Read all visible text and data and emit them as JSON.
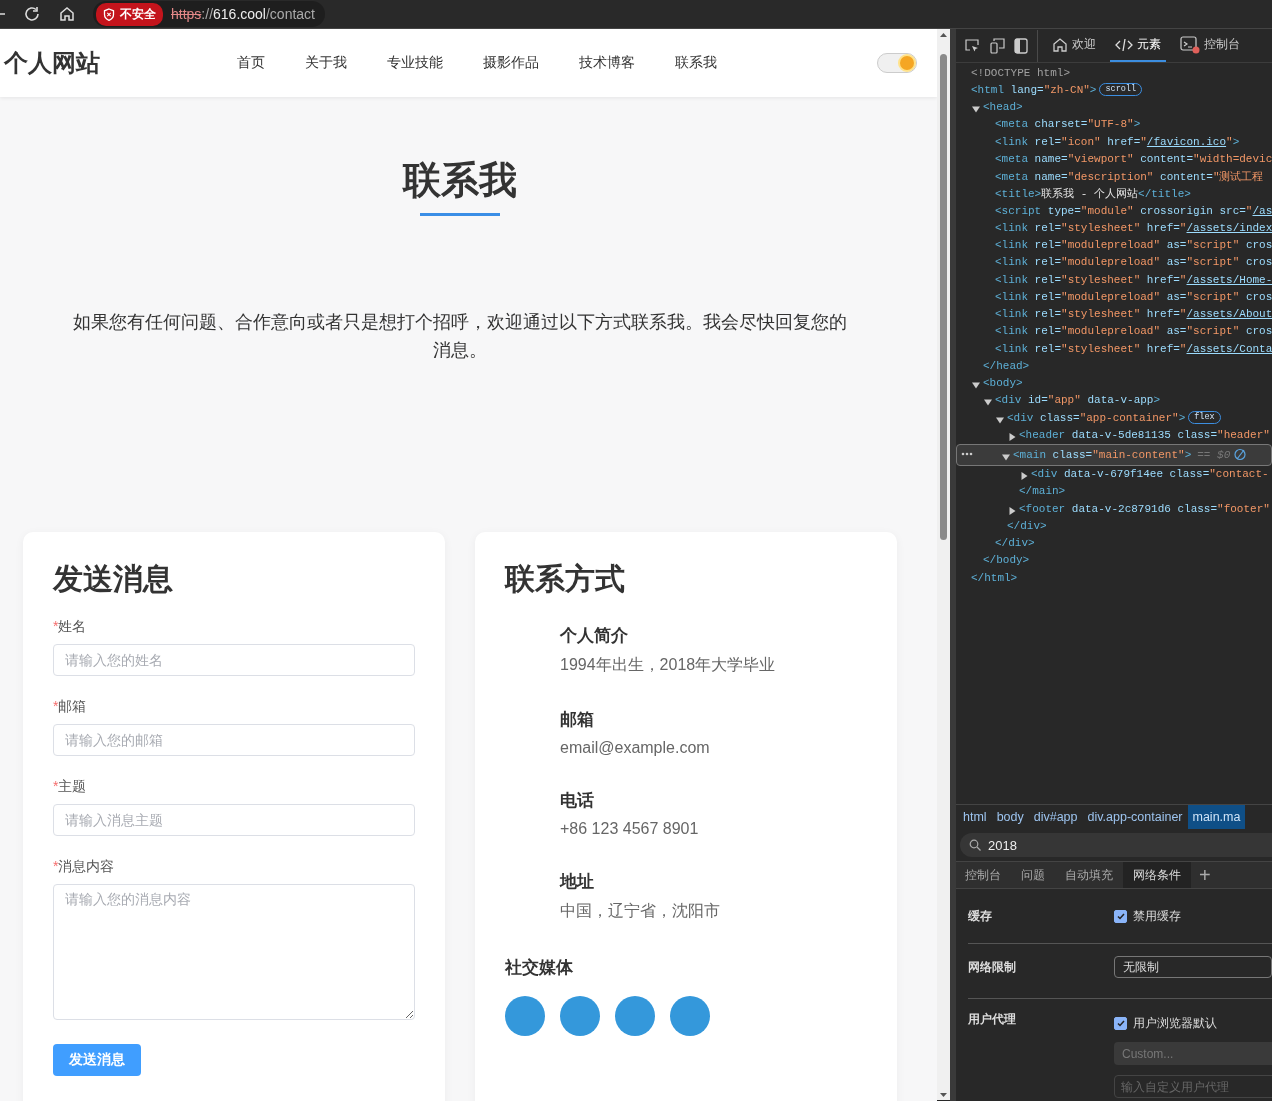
{
  "browser": {
    "security_badge": "不安全",
    "url": {
      "scheme": "https",
      "separator": "://",
      "host": "616.cool",
      "path": "/contact"
    }
  },
  "site": {
    "logo": "个人网站",
    "nav": [
      {
        "label": "首页"
      },
      {
        "label": "关于我"
      },
      {
        "label": "专业技能"
      },
      {
        "label": "摄影作品"
      },
      {
        "label": "技术博客"
      },
      {
        "label": "联系我"
      }
    ],
    "theme_toggle": {
      "on": true
    },
    "title": "联系我",
    "intro": "如果您有任何问题、合作意向或者只是想打个招呼，欢迎通过以下方式联系我。我会尽快回复您的消息。",
    "form": {
      "heading": "发送消息",
      "fields": [
        {
          "kind": "input",
          "label": "姓名",
          "required_mark": "*",
          "placeholder": "请输入您的姓名"
        },
        {
          "kind": "input",
          "label": "邮箱",
          "required_mark": "*",
          "placeholder": "请输入您的邮箱"
        },
        {
          "kind": "input",
          "label": "主题",
          "required_mark": "*",
          "placeholder": "请输入消息主题"
        },
        {
          "kind": "textarea",
          "label": "消息内容",
          "required_mark": "*",
          "placeholder": "请输入您的消息内容"
        }
      ],
      "submit": "发送消息"
    },
    "contact": {
      "heading": "联系方式",
      "items": [
        {
          "title": "个人简介",
          "value": "1994年出生，2018年大学毕业"
        },
        {
          "title": "邮箱",
          "value": "email@example.com"
        },
        {
          "title": "电话",
          "value": "+86 123 4567 8901"
        },
        {
          "title": "地址",
          "value": "中国，辽宁省，沈阳市"
        }
      ],
      "social_heading": "社交媒体",
      "social_links": [
        {
          "kind": "circle"
        },
        {
          "kind": "circle"
        },
        {
          "kind": "circle"
        },
        {
          "kind": "circle"
        }
      ]
    }
  },
  "devtools": {
    "tabs": [
      {
        "label": "欢迎",
        "kind": "home",
        "selected": false
      },
      {
        "label": "元素",
        "kind": "code",
        "selected": true
      },
      {
        "label": "控制台",
        "kind": "console",
        "selected": false
      }
    ],
    "dom_tree": [
      {
        "selected": false,
        "line": [
          {
            "kind": "doctype",
            "text": "<!DOCTYPE html>"
          }
        ]
      },
      {
        "selected": false,
        "badge": "scroll",
        "line": [
          {
            "kind": "tag",
            "text": "<html"
          },
          {
            "kind": "attr",
            "text": " lang="
          },
          {
            "kind": "val",
            "text": "\"zh-CN\""
          },
          {
            "kind": "tag",
            "text": ">"
          }
        ],
        "children": [
          {
            "selected": false,
            "expanded": true,
            "line": [
              {
                "kind": "tag",
                "text": "<head>"
              }
            ],
            "children": [
              {
                "selected": false,
                "line": [
                  {
                    "kind": "tag",
                    "text": "<meta"
                  },
                  {
                    "kind": "attr",
                    "text": " charset="
                  },
                  {
                    "kind": "val",
                    "text": "\"UTF-8\""
                  },
                  {
                    "kind": "tag",
                    "text": ">"
                  }
                ]
              },
              {
                "selected": false,
                "line": [
                  {
                    "kind": "tag",
                    "text": "<link"
                  },
                  {
                    "kind": "attr",
                    "text": " rel="
                  },
                  {
                    "kind": "val",
                    "text": "\"icon\""
                  },
                  {
                    "kind": "attr",
                    "text": " href="
                  },
                  {
                    "kind": "punct",
                    "text": "\""
                  },
                  {
                    "kind": "link",
                    "text": "/favicon.ico"
                  },
                  {
                    "kind": "punct",
                    "text": "\""
                  },
                  {
                    "kind": "tag",
                    "text": ">"
                  }
                ]
              },
              {
                "selected": false,
                "line": [
                  {
                    "kind": "tag",
                    "text": "<meta"
                  },
                  {
                    "kind": "attr",
                    "text": " name="
                  },
                  {
                    "kind": "val",
                    "text": "\"viewport\""
                  },
                  {
                    "kind": "attr",
                    "text": " content="
                  },
                  {
                    "kind": "val",
                    "text": "\"width=devic"
                  }
                ]
              },
              {
                "selected": false,
                "line": [
                  {
                    "kind": "tag",
                    "text": "<meta"
                  },
                  {
                    "kind": "attr",
                    "text": " name="
                  },
                  {
                    "kind": "val",
                    "text": "\"description\""
                  },
                  {
                    "kind": "attr",
                    "text": " content="
                  },
                  {
                    "kind": "val",
                    "text": "\"测试工程"
                  }
                ]
              },
              {
                "selected": false,
                "line": [
                  {
                    "kind": "tag",
                    "text": "<title>"
                  },
                  {
                    "kind": "text",
                    "text": "联系我 - 个人网站"
                  },
                  {
                    "kind": "tag",
                    "text": "</title>"
                  }
                ]
              },
              {
                "selected": false,
                "line": [
                  {
                    "kind": "tag",
                    "text": "<script"
                  },
                  {
                    "kind": "attr",
                    "text": " type="
                  },
                  {
                    "kind": "val",
                    "text": "\"module\""
                  },
                  {
                    "kind": "attr",
                    "text": " crossorigin src="
                  },
                  {
                    "kind": "punct",
                    "text": "\""
                  },
                  {
                    "kind": "link",
                    "text": "/as"
                  }
                ]
              },
              {
                "selected": false,
                "line": [
                  {
                    "kind": "tag",
                    "text": "<link"
                  },
                  {
                    "kind": "attr",
                    "text": " rel="
                  },
                  {
                    "kind": "val",
                    "text": "\"stylesheet\""
                  },
                  {
                    "kind": "attr",
                    "text": " href="
                  },
                  {
                    "kind": "punct",
                    "text": "\""
                  },
                  {
                    "kind": "link",
                    "text": "/assets/index"
                  }
                ]
              },
              {
                "selected": false,
                "line": [
                  {
                    "kind": "tag",
                    "text": "<link"
                  },
                  {
                    "kind": "attr",
                    "text": " rel="
                  },
                  {
                    "kind": "val",
                    "text": "\"modulepreload\""
                  },
                  {
                    "kind": "attr",
                    "text": " as="
                  },
                  {
                    "kind": "val",
                    "text": "\"script\""
                  },
                  {
                    "kind": "attr",
                    "text": " cros"
                  }
                ]
              },
              {
                "selected": false,
                "line": [
                  {
                    "kind": "tag",
                    "text": "<link"
                  },
                  {
                    "kind": "attr",
                    "text": " rel="
                  },
                  {
                    "kind": "val",
                    "text": "\"modulepreload\""
                  },
                  {
                    "kind": "attr",
                    "text": " as="
                  },
                  {
                    "kind": "val",
                    "text": "\"script\""
                  },
                  {
                    "kind": "attr",
                    "text": " cros"
                  }
                ]
              },
              {
                "selected": false,
                "line": [
                  {
                    "kind": "tag",
                    "text": "<link"
                  },
                  {
                    "kind": "attr",
                    "text": " rel="
                  },
                  {
                    "kind": "val",
                    "text": "\"stylesheet\""
                  },
                  {
                    "kind": "attr",
                    "text": " href="
                  },
                  {
                    "kind": "punct",
                    "text": "\""
                  },
                  {
                    "kind": "link",
                    "text": "/assets/Home-"
                  }
                ]
              },
              {
                "selected": false,
                "line": [
                  {
                    "kind": "tag",
                    "text": "<link"
                  },
                  {
                    "kind": "attr",
                    "text": " rel="
                  },
                  {
                    "kind": "val",
                    "text": "\"modulepreload\""
                  },
                  {
                    "kind": "attr",
                    "text": " as="
                  },
                  {
                    "kind": "val",
                    "text": "\"script\""
                  },
                  {
                    "kind": "attr",
                    "text": " cros"
                  }
                ]
              },
              {
                "selected": false,
                "line": [
                  {
                    "kind": "tag",
                    "text": "<link"
                  },
                  {
                    "kind": "attr",
                    "text": " rel="
                  },
                  {
                    "kind": "val",
                    "text": "\"stylesheet\""
                  },
                  {
                    "kind": "attr",
                    "text": " href="
                  },
                  {
                    "kind": "punct",
                    "text": "\""
                  },
                  {
                    "kind": "link",
                    "text": "/assets/About"
                  }
                ]
              },
              {
                "selected": false,
                "line": [
                  {
                    "kind": "tag",
                    "text": "<link"
                  },
                  {
                    "kind": "attr",
                    "text": " rel="
                  },
                  {
                    "kind": "val",
                    "text": "\"modulepreload\""
                  },
                  {
                    "kind": "attr",
                    "text": " as="
                  },
                  {
                    "kind": "val",
                    "text": "\"script\""
                  },
                  {
                    "kind": "attr",
                    "text": " cros"
                  }
                ]
              },
              {
                "selected": false,
                "line": [
                  {
                    "kind": "tag",
                    "text": "<link"
                  },
                  {
                    "kind": "attr",
                    "text": " rel="
                  },
                  {
                    "kind": "val",
                    "text": "\"stylesheet\""
                  },
                  {
                    "kind": "attr",
                    "text": " href="
                  },
                  {
                    "kind": "punct",
                    "text": "\""
                  },
                  {
                    "kind": "link",
                    "text": "/assets/Conta"
                  }
                ]
              }
            ],
            "close": [
              {
                "kind": "tag",
                "text": "</head>"
              }
            ]
          },
          {
            "selected": false,
            "expanded": true,
            "line": [
              {
                "kind": "tag",
                "text": "<body>"
              }
            ],
            "children": [
              {
                "selected": false,
                "expanded": true,
                "line": [
                  {
                    "kind": "tag",
                    "text": "<div"
                  },
                  {
                    "kind": "attr",
                    "text": " id="
                  },
                  {
                    "kind": "val",
                    "text": "\"app\""
                  },
                  {
                    "kind": "attr",
                    "text": " data-v-app"
                  },
                  {
                    "kind": "tag",
                    "text": ">"
                  }
                ],
                "children": [
                  {
                    "selected": false,
                    "expanded": true,
                    "badge": "flex",
                    "line": [
                      {
                        "kind": "tag",
                        "text": "<div"
                      },
                      {
                        "kind": "attr",
                        "text": " class="
                      },
                      {
                        "kind": "val",
                        "text": "\"app-container\""
                      },
                      {
                        "kind": "tag",
                        "text": ">"
                      }
                    ],
                    "children": [
                      {
                        "selected": false,
                        "expanded": false,
                        "line": [
                          {
                            "kind": "tag",
                            "text": "<header"
                          },
                          {
                            "kind": "attr",
                            "text": " data-v-5de81135 class="
                          },
                          {
                            "kind": "val",
                            "text": "\"header\""
                          }
                        ]
                      },
                      {
                        "selected": true,
                        "expanded": true,
                        "suffix": "== $0",
                        "line": [
                          {
                            "kind": "tag",
                            "text": "<main"
                          },
                          {
                            "kind": "attr",
                            "text": " class="
                          },
                          {
                            "kind": "val",
                            "text": "\"main-content\""
                          },
                          {
                            "kind": "tag",
                            "text": ">"
                          }
                        ],
                        "children": [
                          {
                            "selected": false,
                            "expanded": false,
                            "line": [
                              {
                                "kind": "tag",
                                "text": "<div"
                              },
                              {
                                "kind": "attr",
                                "text": " data-v-679f14ee class="
                              },
                              {
                                "kind": "val",
                                "text": "\"contact-"
                              }
                            ]
                          }
                        ],
                        "close": [
                          {
                            "kind": "tag",
                            "text": "</main>"
                          }
                        ]
                      },
                      {
                        "selected": false,
                        "expanded": false,
                        "line": [
                          {
                            "kind": "tag",
                            "text": "<footer"
                          },
                          {
                            "kind": "attr",
                            "text": " data-v-2c8791d6 class="
                          },
                          {
                            "kind": "val",
                            "text": "\"footer\""
                          }
                        ]
                      }
                    ],
                    "close": [
                      {
                        "kind": "tag",
                        "text": "</div>"
                      }
                    ]
                  }
                ],
                "close": [
                  {
                    "kind": "tag",
                    "text": "</div>"
                  }
                ]
              }
            ],
            "close": [
              {
                "kind": "tag",
                "text": "</body>"
              }
            ]
          }
        ],
        "close": [
          {
            "kind": "tag",
            "text": "</html>"
          }
        ]
      }
    ],
    "breadcrumbs": [
      {
        "label": "html",
        "selected": false
      },
      {
        "label": "body",
        "selected": false
      },
      {
        "label": "div#app",
        "selected": false
      },
      {
        "label": "div.app-container",
        "selected": false
      },
      {
        "label": "main.ma",
        "selected": true
      }
    ],
    "search": {
      "value": "2018"
    },
    "drawer_tabs": [
      {
        "label": "控制台",
        "selected": false
      },
      {
        "label": "问题",
        "selected": false
      },
      {
        "label": "自动填充",
        "selected": false
      },
      {
        "label": "网络条件",
        "selected": true
      }
    ],
    "add_tab": "+",
    "network_conditions": {
      "cache": {
        "label": "缓存",
        "option": "禁用缓存",
        "checked": true
      },
      "throttling": {
        "label": "网络限制",
        "value": "无限制"
      },
      "user_agent": {
        "label": "用户代理",
        "option": "用户浏览器默认",
        "checked": true,
        "select": "Custom...",
        "select_disabled": true,
        "placeholder": "输入自定义用户代理"
      }
    }
  }
}
